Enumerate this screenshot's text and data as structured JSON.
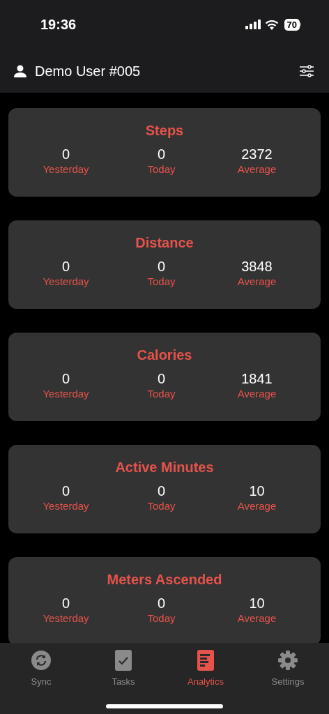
{
  "status_bar": {
    "time": "19:36",
    "battery": "70"
  },
  "header": {
    "user": "Demo User #005"
  },
  "cards": [
    {
      "title": "Steps",
      "stats": [
        {
          "value": "0",
          "label": "Yesterday"
        },
        {
          "value": "0",
          "label": "Today"
        },
        {
          "value": "2372",
          "label": "Average"
        }
      ]
    },
    {
      "title": "Distance",
      "stats": [
        {
          "value": "0",
          "label": "Yesterday"
        },
        {
          "value": "0",
          "label": "Today"
        },
        {
          "value": "3848",
          "label": "Average"
        }
      ]
    },
    {
      "title": "Calories",
      "stats": [
        {
          "value": "0",
          "label": "Yesterday"
        },
        {
          "value": "0",
          "label": "Today"
        },
        {
          "value": "1841",
          "label": "Average"
        }
      ]
    },
    {
      "title": "Active Minutes",
      "stats": [
        {
          "value": "0",
          "label": "Yesterday"
        },
        {
          "value": "0",
          "label": "Today"
        },
        {
          "value": "10",
          "label": "Average"
        }
      ]
    },
    {
      "title": "Meters Ascended",
      "stats": [
        {
          "value": "0",
          "label": "Yesterday"
        },
        {
          "value": "0",
          "label": "Today"
        },
        {
          "value": "10",
          "label": "Average"
        }
      ]
    }
  ],
  "tabs": [
    {
      "kind": "sync",
      "label": "Sync",
      "selected": false
    },
    {
      "kind": "tasks",
      "label": "Tasks",
      "selected": false
    },
    {
      "kind": "analytics",
      "label": "Analytics",
      "selected": true
    },
    {
      "kind": "settings",
      "label": "Settings",
      "selected": false
    }
  ]
}
